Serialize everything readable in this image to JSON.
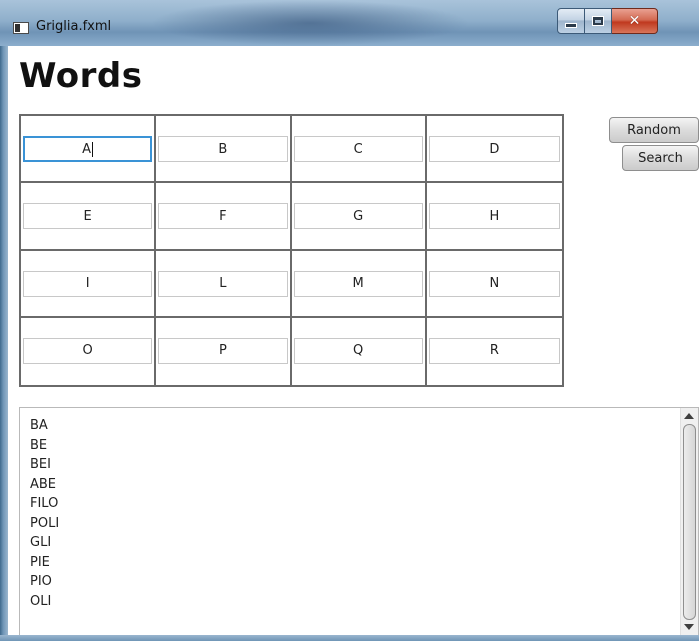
{
  "window": {
    "title": "Griglia.fxml",
    "controls": {
      "minimize": "minimize-icon",
      "maximize": "maximize-icon",
      "close": "close-icon"
    }
  },
  "heading": "Words",
  "grid": {
    "rows": [
      [
        "A",
        "B",
        "C",
        "D"
      ],
      [
        "E",
        "F",
        "G",
        "H"
      ],
      [
        "I",
        "L",
        "M",
        "N"
      ],
      [
        "O",
        "P",
        "Q",
        "R"
      ]
    ],
    "focused_cell": "A"
  },
  "buttons": {
    "random": "Random",
    "search": "Search"
  },
  "results": [
    "BA",
    "BE",
    "BEI",
    "ABE",
    "FILO",
    "POLI",
    "GLI",
    "PIE",
    "PIO",
    "OLI"
  ],
  "colors": {
    "focus": "#3a93d6",
    "close_button": "#c0391f"
  }
}
